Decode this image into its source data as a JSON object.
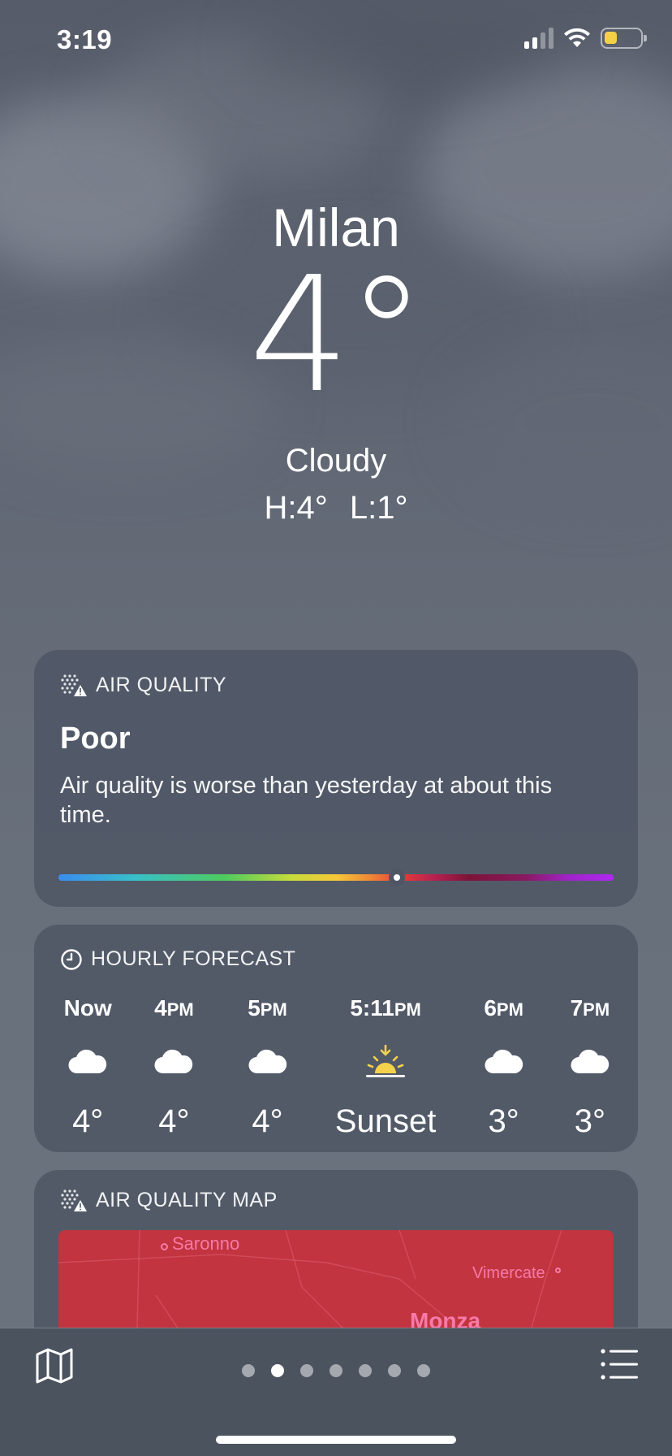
{
  "status_bar": {
    "time": "3:19",
    "signal_bars_active": 2,
    "battery_level": 0.35,
    "battery_color": "#f4d046"
  },
  "weather": {
    "city": "Milan",
    "temperature": "4°",
    "condition": "Cloudy",
    "high": "H:4°",
    "low": "L:1°"
  },
  "air_quality": {
    "title": "AIR QUALITY",
    "level": "Poor",
    "description": "Air quality is worse than yesterday at about this time.",
    "scale_position": 0.61,
    "icon": "air-quality-icon"
  },
  "hourly": {
    "title": "HOURLY FORECAST",
    "icon": "clock-icon",
    "items": [
      {
        "time": "Now",
        "suffix": "",
        "icon": "cloud-icon",
        "value": "4°"
      },
      {
        "time": "4",
        "suffix": "PM",
        "icon": "cloud-icon",
        "value": "4°"
      },
      {
        "time": "5",
        "suffix": "PM",
        "icon": "cloud-icon",
        "value": "4°"
      },
      {
        "time": "5:11",
        "suffix": "PM",
        "icon": "sunset-icon",
        "value": "Sunset"
      },
      {
        "time": "6",
        "suffix": "PM",
        "icon": "cloud-icon",
        "value": "3°"
      },
      {
        "time": "7",
        "suffix": "PM",
        "icon": "cloud-icon",
        "value": "3°"
      }
    ]
  },
  "air_quality_map": {
    "title": "AIR QUALITY MAP",
    "icon": "air-quality-icon",
    "places": [
      "Saronno",
      "Vimercate",
      "Monza"
    ],
    "map_color": "#c2343f"
  },
  "tab_bar": {
    "page_count": 7,
    "active_page": 1,
    "left_icon": "map-icon",
    "right_icon": "list-icon"
  }
}
